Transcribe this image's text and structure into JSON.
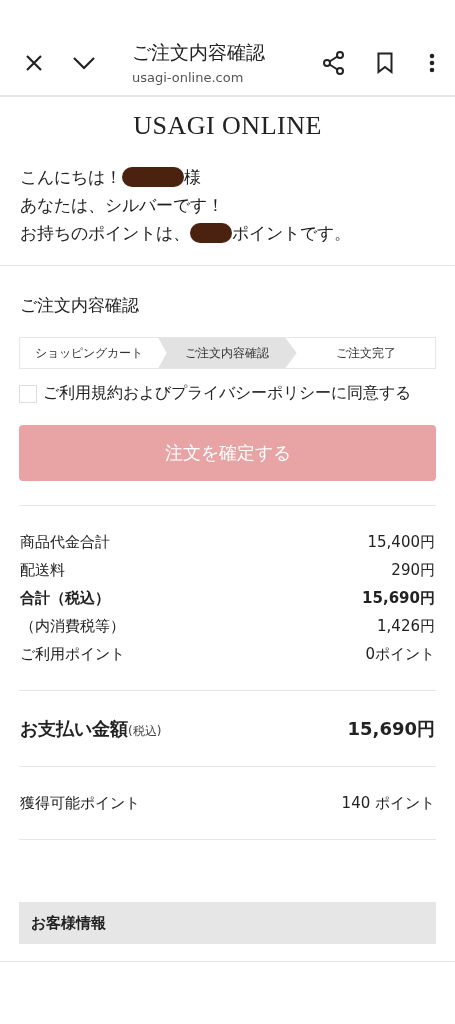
{
  "browser_bar": {
    "title": "ご注文内容確認",
    "url": "usagi-online.com"
  },
  "logo": "USAGI ONLINE",
  "greeting": [
    {
      "before": "こんにちは！",
      "redacted": true,
      "after": "様"
    },
    {
      "before": "あなたは、シルバーです！",
      "redacted": false
    },
    {
      "before": "お持ちのポイントは、",
      "redacted": true,
      "after": "ポイントです。"
    }
  ],
  "section_title": "ご注文内容確認",
  "steps": [
    {
      "label": "ショッピングカート",
      "selected": false
    },
    {
      "label": "ご注文内容確認",
      "selected": true
    },
    {
      "label": "ご注文完了",
      "selected": false
    }
  ],
  "agreement": {
    "label": "ご利用規約およびプライバシーポリシーに同意する",
    "checked": false
  },
  "confirm_button": {
    "label": "注文を確定する",
    "disabled": true
  },
  "summary": [
    {
      "label": "商品代金合計",
      "value": "15,400円",
      "bold": false
    },
    {
      "label": "配送料",
      "value": "290円",
      "bold": false
    },
    {
      "label": "合計（税込）",
      "value": "15,690円",
      "bold": true
    },
    {
      "label": "（内消費税等）",
      "value": "1,426円",
      "bold": false
    },
    {
      "label": "ご利用ポイント",
      "value": "0ポイント",
      "bold": false
    }
  ],
  "payment": {
    "label": "お支払い金額",
    "note": "(税込)",
    "value": "15,690円"
  },
  "earned_points": {
    "label": "獲得可能ポイント",
    "value": "140 ポイント"
  },
  "customer_info": {
    "heading": "お客様情報"
  }
}
